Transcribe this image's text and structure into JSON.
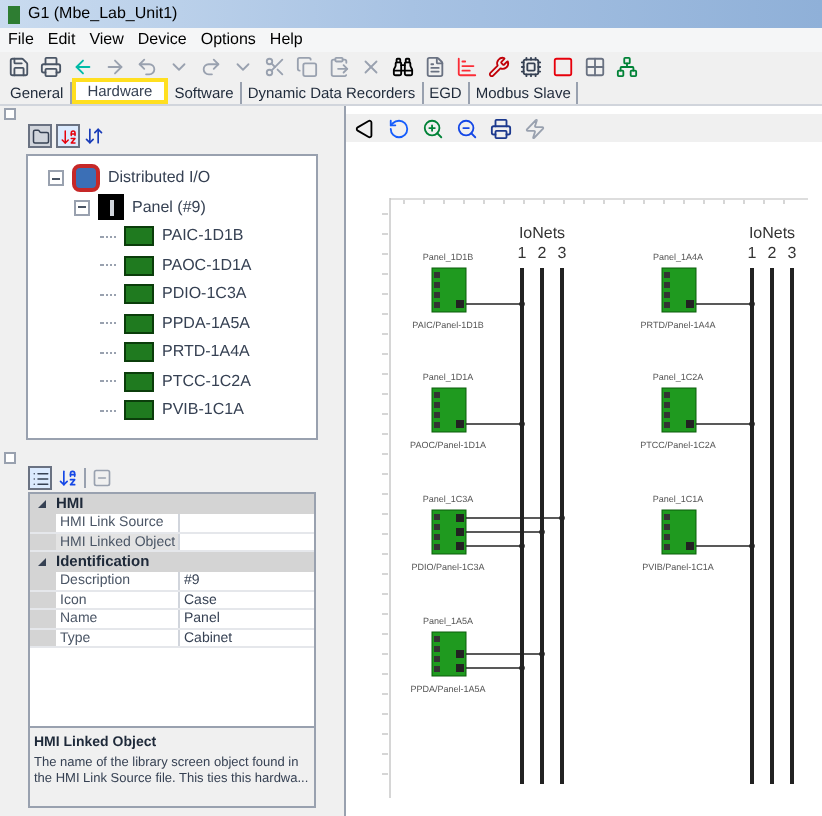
{
  "window": {
    "title": "G1 (Mbe_Lab_Unit1)"
  },
  "menu": [
    "File",
    "Edit",
    "View",
    "Device",
    "Options",
    "Help"
  ],
  "tabs": [
    {
      "label": "General",
      "selected": false
    },
    {
      "label": "Hardware",
      "selected": true
    },
    {
      "label": "Software",
      "selected": false
    },
    {
      "label": "Dynamic Data Recorders",
      "selected": false
    },
    {
      "label": "EGD",
      "selected": false
    },
    {
      "label": "Modbus Slave",
      "selected": false
    }
  ],
  "tree": [
    {
      "label": "Distributed I/O",
      "kind": "folder",
      "expanded": true,
      "children": [
        {
          "label": "Panel (#9)",
          "kind": "panel",
          "expanded": true,
          "children": [
            {
              "label": "PAIC-1D1B",
              "kind": "module"
            },
            {
              "label": "PAOC-1D1A",
              "kind": "module"
            },
            {
              "label": "PDIO-1C3A",
              "kind": "module"
            },
            {
              "label": "PPDA-1A5A",
              "kind": "module"
            },
            {
              "label": "PRTD-1A4A",
              "kind": "module"
            },
            {
              "label": "PTCC-1C2A",
              "kind": "module"
            },
            {
              "label": "PVIB-1C1A",
              "kind": "module"
            }
          ]
        }
      ]
    }
  ],
  "properties": [
    {
      "name": "HMI",
      "expanded": true,
      "rows": [
        {
          "name": "HMI Link Source",
          "selected": false
        },
        {
          "name": "HMI Linked Object",
          "selected": true
        }
      ]
    },
    {
      "name": "Identification",
      "expanded": true,
      "rows": [
        {
          "name": "Description",
          "value": "#9",
          "selected": false
        },
        {
          "name": "Icon",
          "value": "Case",
          "selected": false
        },
        {
          "name": "Name",
          "value": "Panel",
          "selected": false
        },
        {
          "name": "Type",
          "value": "Cabinet",
          "selected": false
        }
      ]
    }
  ],
  "description": {
    "title": "HMI Linked Object",
    "text": "The name of the library screen object found in the HMI Link Source file.  This ties this hardwa..."
  },
  "diagram": {
    "groups": [
      {
        "title": "IoNets",
        "nets": [
          "1",
          "2",
          "3"
        ],
        "devices": [
          {
            "top_label": "Panel_1D1B",
            "bottom_label": "PAIC/Panel-1D1B",
            "connected": [
              true,
              false,
              false
            ]
          },
          {
            "top_label": "Panel_1D1A",
            "bottom_label": "PAOC/Panel-1D1A",
            "connected": [
              true,
              false,
              false
            ]
          },
          {
            "top_label": "Panel_1C3A",
            "bottom_label": "PDIO/Panel-1C3A",
            "connected": [
              true,
              true,
              true
            ]
          },
          {
            "top_label": "Panel_1A5A",
            "bottom_label": "PPDA/Panel-1A5A",
            "connected": [
              true,
              true,
              false
            ]
          }
        ]
      },
      {
        "title": "IoNets",
        "nets": [
          "1",
          "2",
          "3"
        ],
        "devices": [
          {
            "top_label": "Panel_1A4A",
            "bottom_label": "PRTD/Panel-1A4A",
            "connected": [
              true,
              false,
              false
            ]
          },
          {
            "top_label": "Panel_1C2A",
            "bottom_label": "PTCC/Panel-1C2A",
            "connected": [
              true,
              false,
              false
            ]
          },
          {
            "top_label": "Panel_1C1A",
            "bottom_label": "PVIB/Panel-1C1A",
            "connected": [
              true,
              false,
              false
            ]
          }
        ]
      }
    ]
  }
}
